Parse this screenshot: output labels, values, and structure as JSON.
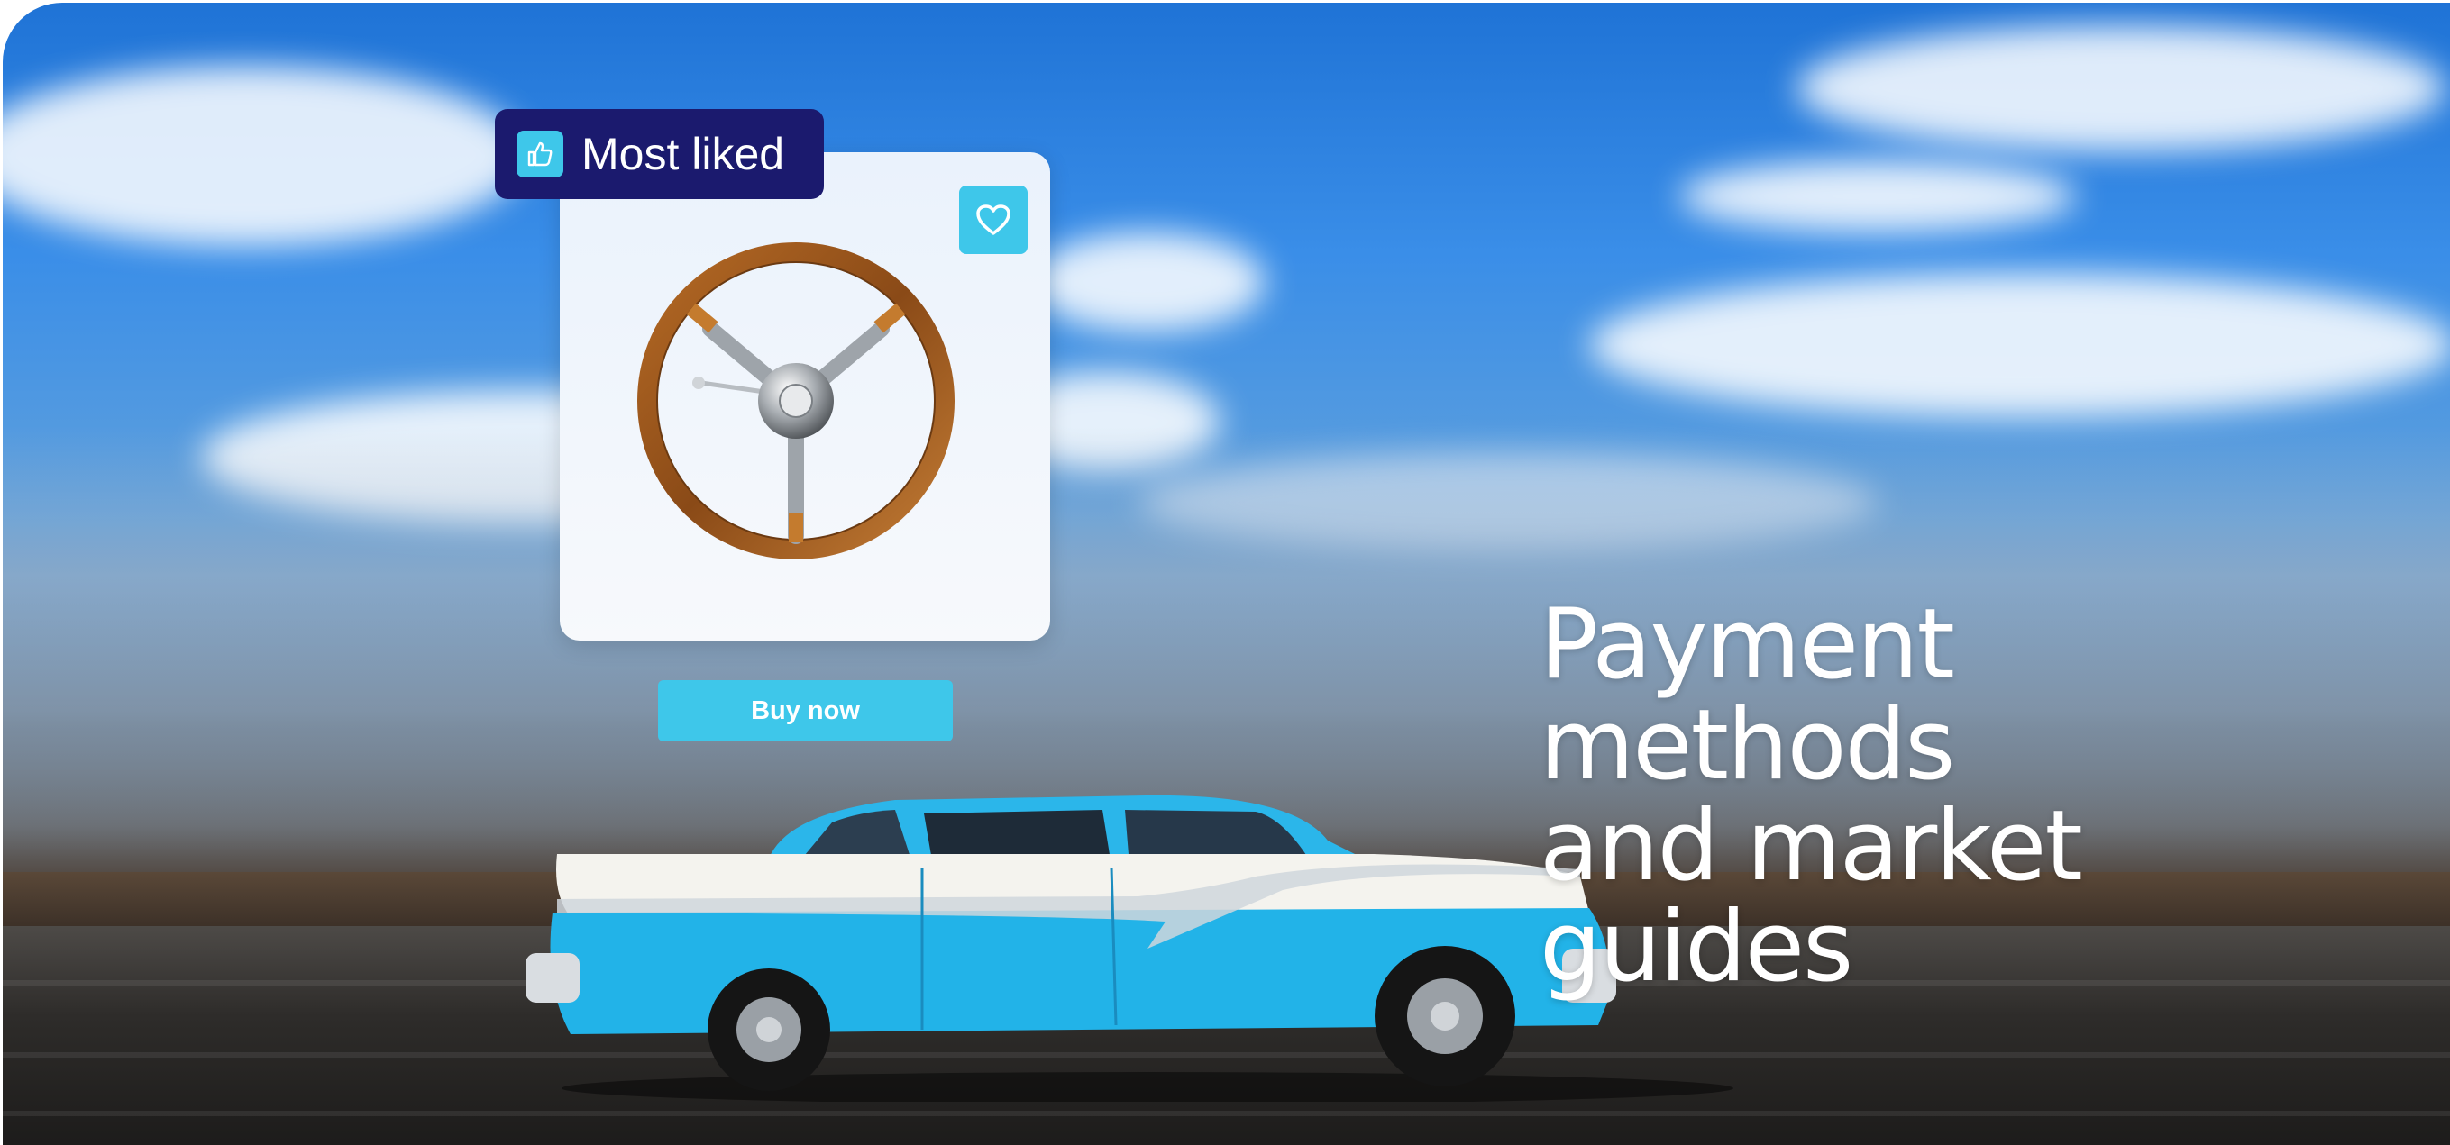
{
  "badge": {
    "label": "Most liked",
    "icon": "thumbs-up-icon"
  },
  "product_card": {
    "favorite_icon": "heart-icon",
    "image": "steering-wheel"
  },
  "buy_button": {
    "label": "Buy now"
  },
  "headline": {
    "line1": "Payment methods",
    "line2": "and market guides"
  },
  "colors": {
    "accent": "#3ec7ea",
    "badge_bg": "#1b1a6e",
    "card_bg": "#f2f6fb",
    "text_light": "#ffffff"
  }
}
